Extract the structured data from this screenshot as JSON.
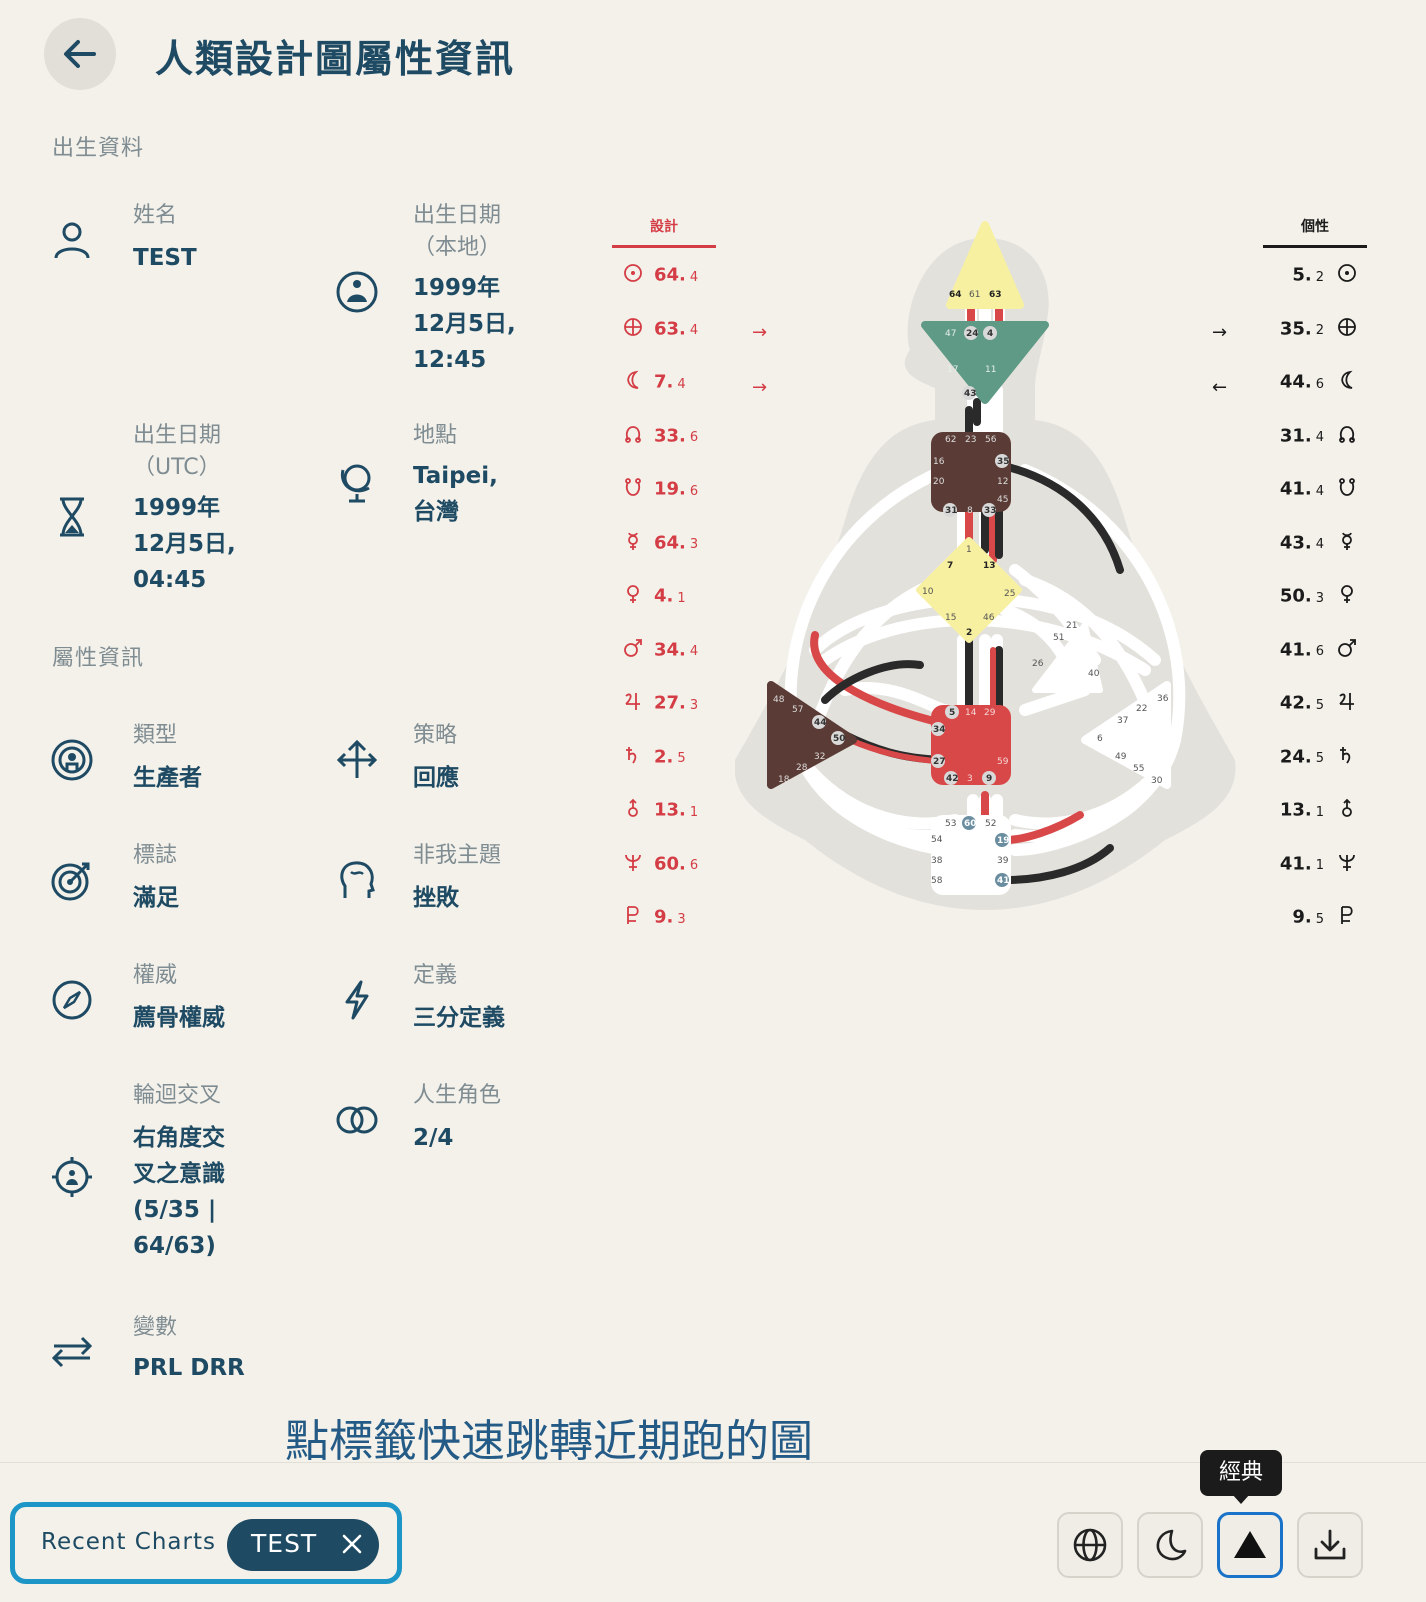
{
  "header": {
    "title": "人類設計圖屬性資訊"
  },
  "birth": {
    "section": "出生資料",
    "name_label": "姓名",
    "name_value": "TEST",
    "local_label": "出生日期\n（本地）",
    "local_value": "1999年\n12月5日,\n12:45",
    "utc_label": "出生日期\n（UTC）",
    "utc_value": "1999年\n12月5日,\n04:45",
    "place_label": "地點",
    "place_value": "Taipei,\n台灣"
  },
  "attributes": {
    "section": "屬性資訊",
    "type_label": "類型",
    "type_value": "生產者",
    "strategy_label": "策略",
    "strategy_value": "回應",
    "signature_label": "標誌",
    "signature_value": "滿足",
    "notself_label": "非我主題",
    "notself_value": "挫敗",
    "authority_label": "權威",
    "authority_value": "薦骨權威",
    "definition_label": "定義",
    "definition_value": "三分定義",
    "cross_label": "輪迴交叉",
    "cross_value": "右角度交\n叉之意識\n(5/35 |\n64/63)",
    "profile_label": "人生角色",
    "profile_value": "2/4",
    "variable_label": "變數",
    "variable_value": "PRL DRR"
  },
  "design": {
    "heading": "設計",
    "color": "#d43d45",
    "rows": [
      {
        "gate": "64.",
        "line": "4"
      },
      {
        "gate": "63.",
        "line": "4"
      },
      {
        "gate": "7.",
        "line": "4"
      },
      {
        "gate": "33.",
        "line": "6"
      },
      {
        "gate": "19.",
        "line": "6"
      },
      {
        "gate": "64.",
        "line": "3"
      },
      {
        "gate": "4.",
        "line": "1"
      },
      {
        "gate": "34.",
        "line": "4"
      },
      {
        "gate": "27.",
        "line": "3"
      },
      {
        "gate": "2.",
        "line": "5"
      },
      {
        "gate": "13.",
        "line": "1"
      },
      {
        "gate": "60.",
        "line": "6"
      },
      {
        "gate": "9.",
        "line": "3"
      }
    ],
    "planets": [
      "sun",
      "earth",
      "moon",
      "north-node",
      "south-node",
      "mercury",
      "venus",
      "mars",
      "jupiter",
      "saturn",
      "uranus",
      "neptune",
      "pluto"
    ]
  },
  "personality": {
    "heading": "個性",
    "color": "#1b1b1b",
    "rows": [
      {
        "gate": "5.",
        "line": "2"
      },
      {
        "gate": "35.",
        "line": "2"
      },
      {
        "gate": "44.",
        "line": "6"
      },
      {
        "gate": "31.",
        "line": "4"
      },
      {
        "gate": "41.",
        "line": "4"
      },
      {
        "gate": "43.",
        "line": "4"
      },
      {
        "gate": "50.",
        "line": "3"
      },
      {
        "gate": "41.",
        "line": "6"
      },
      {
        "gate": "42.",
        "line": "5"
      },
      {
        "gate": "24.",
        "line": "5"
      },
      {
        "gate": "13.",
        "line": "1"
      },
      {
        "gate": "41.",
        "line": "1"
      },
      {
        "gate": "9.",
        "line": "5"
      }
    ]
  },
  "bodygraph": {
    "head": [
      "64",
      "61",
      "63"
    ],
    "ajna": [
      "47",
      "24",
      "4",
      "17",
      "11",
      "43"
    ],
    "throat": [
      "62",
      "23",
      "56",
      "16",
      "35",
      "20",
      "12",
      "45",
      "31",
      "8",
      "33"
    ],
    "g": [
      "1",
      "7",
      "13",
      "10",
      "25",
      "15",
      "46",
      "2"
    ],
    "heart": [
      "21",
      "51",
      "26",
      "40"
    ],
    "spleen": [
      "48",
      "57",
      "44",
      "50",
      "32",
      "28",
      "18"
    ],
    "sacral": [
      "5",
      "14",
      "29",
      "34",
      "27",
      "59",
      "42",
      "3",
      "9"
    ],
    "solar": [
      "36",
      "22",
      "37",
      "6",
      "49",
      "55",
      "30"
    ],
    "root": [
      "53",
      "60",
      "52",
      "54",
      "19",
      "38",
      "39",
      "58",
      "41"
    ],
    "colors": {
      "head": "#f7f0a0",
      "ajna": "#5f9a86",
      "throat": "#5a3b35",
      "g": "#f7f0a0",
      "sacral": "#d94848",
      "spleen": "#5a3b35",
      "white": "#ffffff",
      "channel_red": "#d94848",
      "channel_black": "#2a2a2a",
      "body": "#e3e1dc"
    }
  },
  "caption": "點標籤快速跳轉近期跑的圖",
  "recent": {
    "label": "Recent Charts",
    "chip": "TEST"
  },
  "tooltip": "經典",
  "toolbar": [
    "globe-icon",
    "moon-icon",
    "triangle-icon",
    "download-icon"
  ]
}
